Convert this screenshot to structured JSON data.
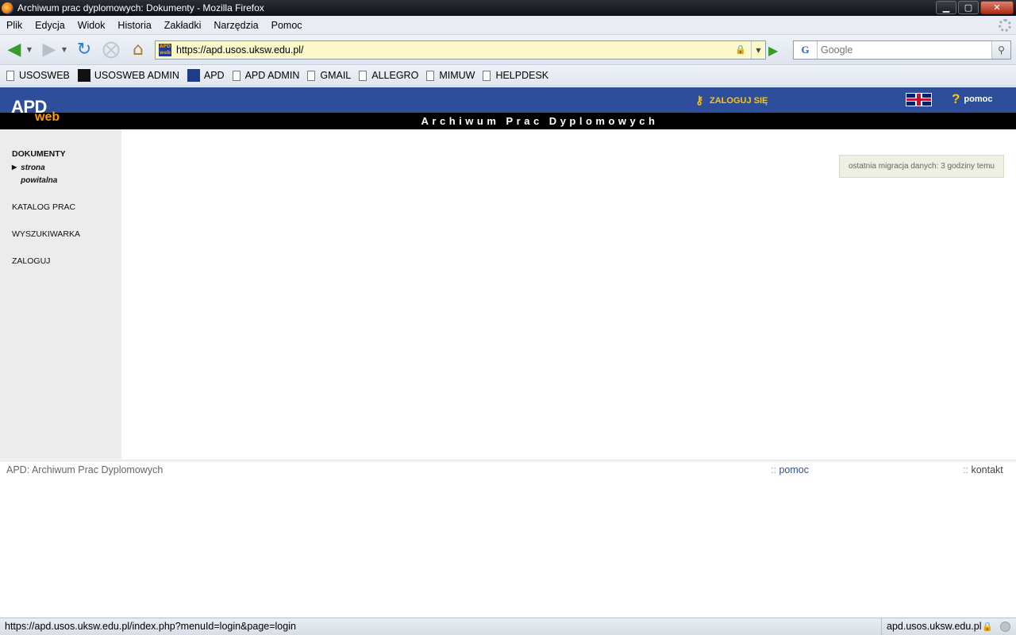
{
  "window": {
    "title": "Archiwum prac dyplomowych: Dokumenty - Mozilla Firefox",
    "buttons": {
      "minimize": "▁",
      "maximize": "▢",
      "close": "✕"
    }
  },
  "menubar": {
    "items": [
      "Plik",
      "Edycja",
      "Widok",
      "Historia",
      "Zakładki",
      "Narzędzia",
      "Pomoc"
    ]
  },
  "navbar": {
    "url": "https://apd.usos.uksw.edu.pl/",
    "search_placeholder": "Google",
    "search_engine_glyph": "G",
    "site_icon_text": "APD web"
  },
  "bookmarks": [
    {
      "label": "USOSWEB",
      "icon": "page-icon"
    },
    {
      "label": "USOSWEB ADMIN",
      "icon": "usos-icon"
    },
    {
      "label": "APD",
      "icon": "apd-icon"
    },
    {
      "label": "APD ADMIN",
      "icon": "page-icon"
    },
    {
      "label": "GMAIL",
      "icon": "page-icon"
    },
    {
      "label": "ALLEGRO",
      "icon": "page-icon"
    },
    {
      "label": "MIMUW",
      "icon": "page-icon"
    },
    {
      "label": "HELPDESK",
      "icon": "page-icon"
    }
  ],
  "apd": {
    "logo_main": "APD",
    "logo_sub": "web",
    "login_label": "ZALOGUJ SIĘ",
    "help_label": "pomoc",
    "banner": "Archiwum Prac Dyplomowych",
    "colors": {
      "header": "#2e4e9c",
      "accent": "#ff9c00",
      "link_yellow": "#ffc600"
    }
  },
  "sidebar": {
    "section": "DOKUMENTY",
    "current": "strona powitalna",
    "links": [
      "KATALOG PRAC",
      "WYSZUKIWARKA",
      "ZALOGUJ"
    ]
  },
  "main": {
    "migration_note": "ostatnia migracja danych: 3 godziny temu"
  },
  "footer": {
    "left": "APD: Archiwum Prac Dyplomowych",
    "separator": "::",
    "help": "pomoc",
    "contact": "kontakt"
  },
  "statusbar": {
    "link": "https://apd.usos.uksw.edu.pl/index.php?menuId=login&page=login",
    "host": "apd.usos.uksw.edu.pl"
  }
}
